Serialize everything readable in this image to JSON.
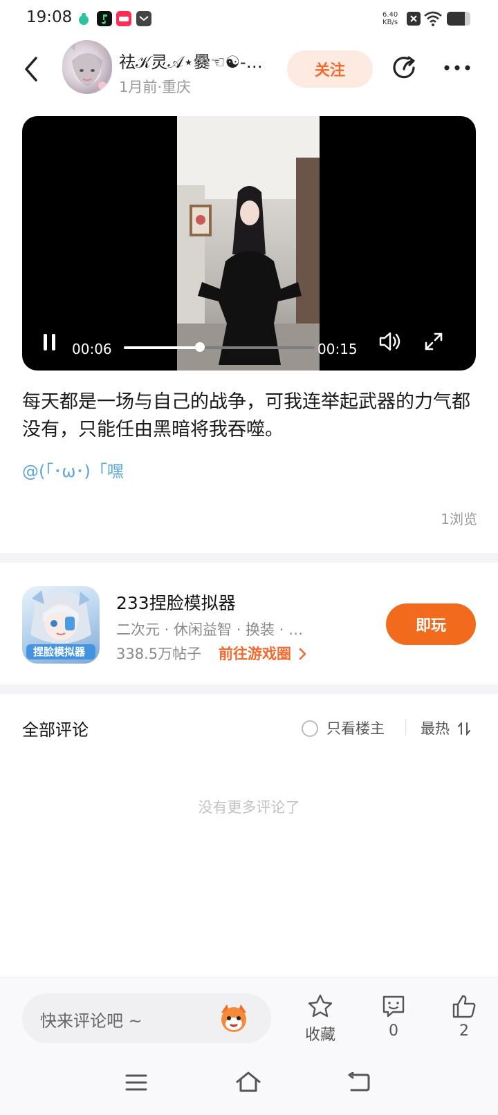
{
  "status_bar": {
    "time": "19:08",
    "net_speed_value": "6.40",
    "net_speed_unit": "KB/s",
    "app_icons": [
      "mint-badge-icon",
      "music-app-icon",
      "red-app-icon",
      "mail-box-icon"
    ],
    "battery_level": 0.75
  },
  "header": {
    "username": "祛𝒦灵𝒜⋆爨☜☯-…",
    "meta": "1月前·重庆",
    "follow_label": "关注"
  },
  "video": {
    "current_time": "00:06",
    "duration": "00:15",
    "progress": 0.4,
    "state": "playing"
  },
  "post": {
    "text": "每天都是一场与自己的战争，可我连举起武器的力气都没有，只能任由黑暗将我吞噬。",
    "mention": "@(「･ω･)「嘿",
    "views": "1浏览"
  },
  "game": {
    "name": "233捏脸模拟器",
    "icon_label": "捏脸模拟器",
    "tags": "二次元 · 休闲益智 · 换装 · …",
    "posts": "338.5万帖子",
    "link": "前往游戏圈",
    "play_label": "即玩"
  },
  "comments": {
    "title": "全部评论",
    "op_only_label": "只看楼主",
    "sort_label": "最热",
    "empty_text": "没有更多评论了"
  },
  "bottom": {
    "input_placeholder": "快来评论吧 ~",
    "favorite_label": "收藏",
    "comment_count": "0",
    "like_count": "2"
  },
  "colors": {
    "accent": "#f26a1b",
    "mention": "#5aa7d8",
    "follow_bg": "#fdebe2"
  }
}
